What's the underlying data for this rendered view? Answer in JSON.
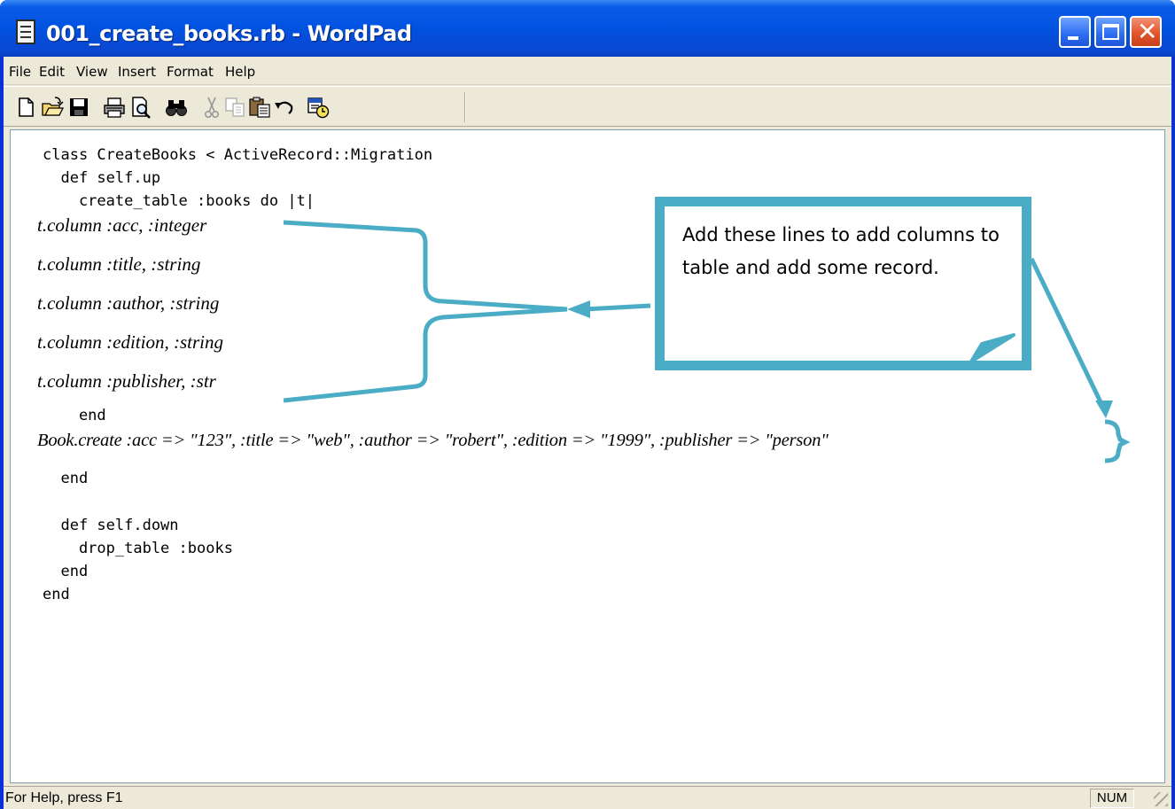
{
  "window": {
    "title": "001_create_books.rb - WordPad",
    "controls": {
      "minimize": "minimize",
      "maximize": "maximize",
      "close": "✕"
    }
  },
  "menubar": {
    "items": [
      "File",
      "Edit",
      "View",
      "Insert",
      "Format",
      "Help"
    ]
  },
  "toolbar": {
    "buttons": [
      "new-document-icon",
      "open-folder-icon",
      "save-disk-icon",
      "print-icon",
      "print-preview-icon",
      "find-binoculars-icon",
      "cut-scissors-icon",
      "copy-icon",
      "paste-icon",
      "undo-arrow-icon",
      "insert-date-time-icon"
    ]
  },
  "document": {
    "lines": {
      "class_line": "class CreateBooks < ActiveRecord::Migration",
      "def_up": "  def self.up",
      "create_table": "    create_table :books do |t|",
      "col_acc": "t.column :acc, :integer",
      "col_title": "t.column :title, :string",
      "col_author": "t.column :author, :string",
      "col_edition": "t.column :edition, :string",
      "col_publisher": "t.column :publisher, :str",
      "end_block": "    end",
      "book_create": "Book.create :acc => \"123\", :title => \"web\", :author => \"robert\", :edition => \"1999\", :publisher => \"person\"",
      "end_up": "  end",
      "def_down": "  def self.down",
      "drop_table": "    drop_table :books",
      "end_down": "  end",
      "end_class": "end"
    }
  },
  "callout": {
    "text": "Add these lines to add columns to table and add some record."
  },
  "statusbar": {
    "help_text": "For Help, press F1",
    "num_indicator": "NUM"
  },
  "colors": {
    "accent": "#4bacc6",
    "titlebar": "#0052e0",
    "chrome": "#ece9d8"
  }
}
